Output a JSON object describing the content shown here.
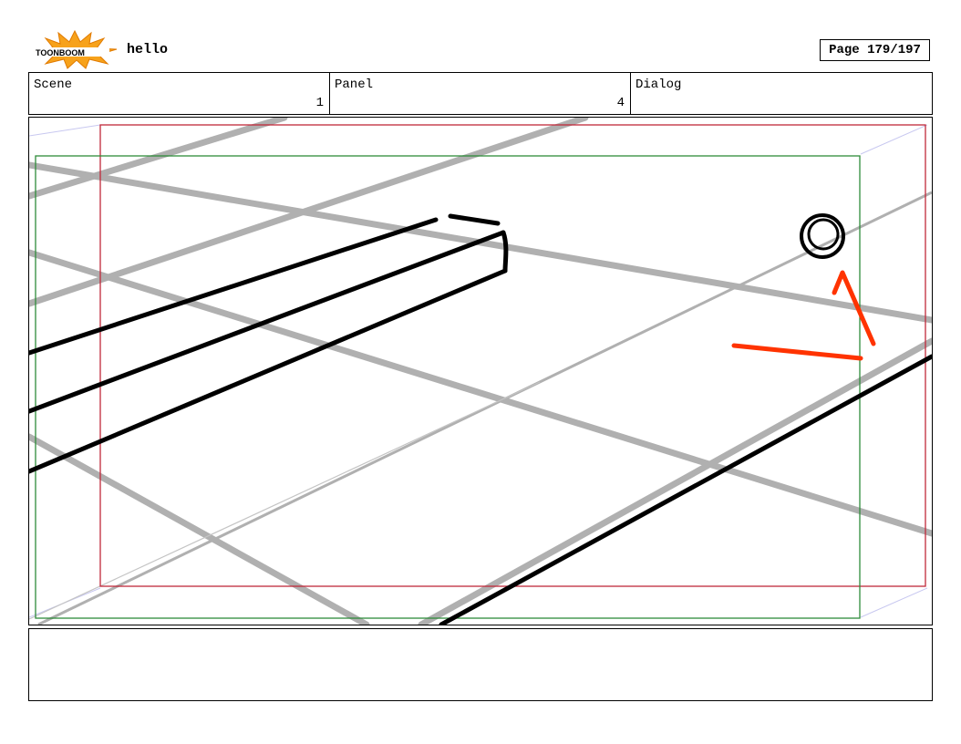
{
  "header": {
    "logo_text": "TOONBOOM",
    "project_title": "hello",
    "page_counter": "Page 179/197"
  },
  "info_row": {
    "scene_label": "Scene",
    "scene_value": "1",
    "panel_label": "Panel",
    "panel_value": "4",
    "dialog_label": "Dialog",
    "dialog_value": ""
  },
  "panel_drawing": {
    "safe_frame_color": "#c0283a",
    "action_frame_color": "#2e8b3a",
    "perspective_guide_color": "#b0b0b0",
    "annotation_color": "#ff3300",
    "ink_color": "#000000"
  },
  "notes": {
    "text": ""
  }
}
